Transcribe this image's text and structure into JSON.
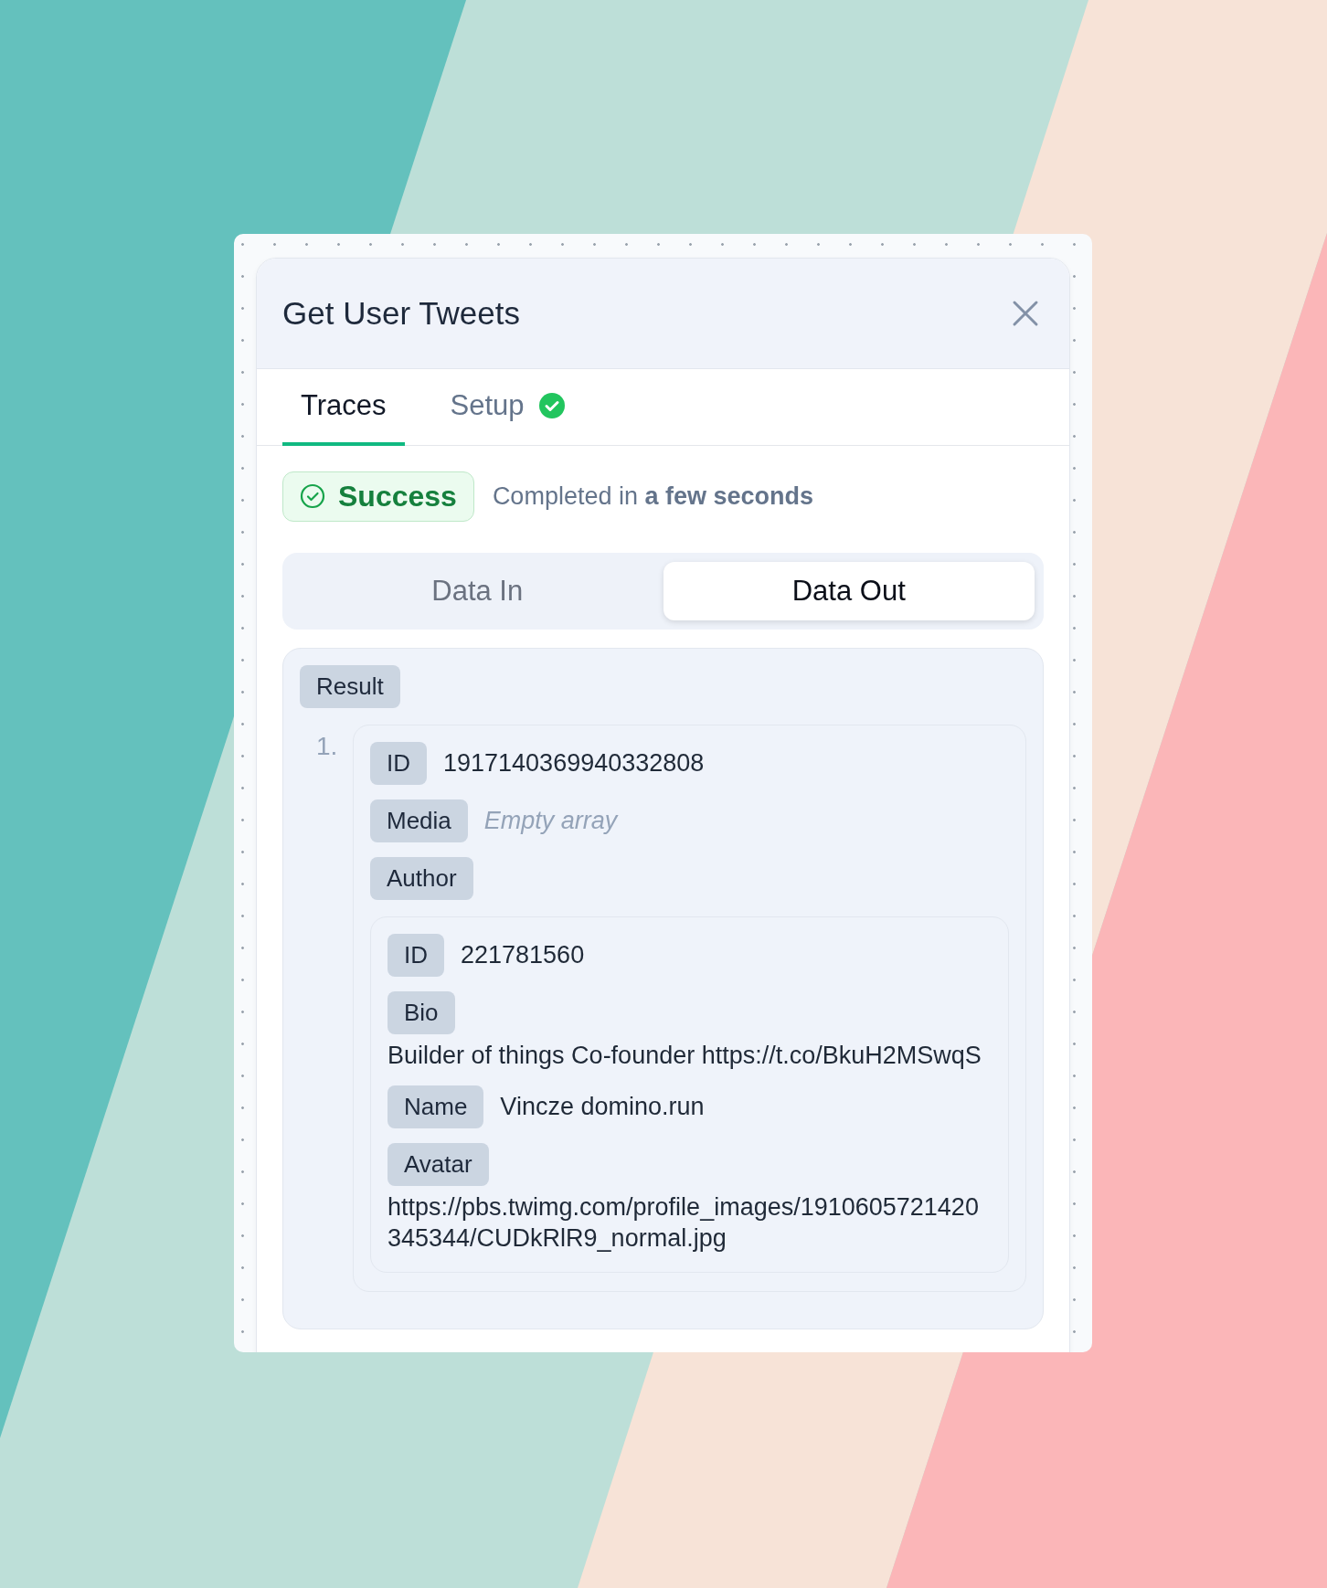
{
  "dialog": {
    "title": "Get User Tweets",
    "tabs": [
      {
        "label": "Traces",
        "selected": true,
        "done": false
      },
      {
        "label": "Setup",
        "selected": false,
        "done": true
      }
    ],
    "run": {
      "status": "Success",
      "message": "Completed in **a few seconds**"
    },
    "data_toggle": [
      {
        "label": "Data In",
        "selected": false
      },
      {
        "label": "Data Out",
        "selected": true
      }
    ],
    "result": {
      "label": "Result",
      "items": [
        {
          "number": "1.",
          "fields": [
            {
              "key": "ID",
              "kind": "inline",
              "value": "1917140369940332808"
            },
            {
              "key": "Media",
              "kind": "empty",
              "value": "Empty array"
            },
            {
              "key": "Author",
              "kind": "object",
              "fields": [
                {
                  "key": "ID",
                  "kind": "inline",
                  "value": "221781560"
                },
                {
                  "key": "Bio",
                  "kind": "block",
                  "value": "Builder of things Co-founder https://t.co/BkuH2MSwqS"
                },
                {
                  "key": "Name",
                  "kind": "inline",
                  "value": "Vincze domino.run"
                },
                {
                  "key": "Avatar",
                  "kind": "block",
                  "value": "https://pbs.twimg.com/profile_images/1910605721420345344/CUDkRlR9_normal.jpg"
                }
              ]
            }
          ]
        }
      ]
    }
  }
}
